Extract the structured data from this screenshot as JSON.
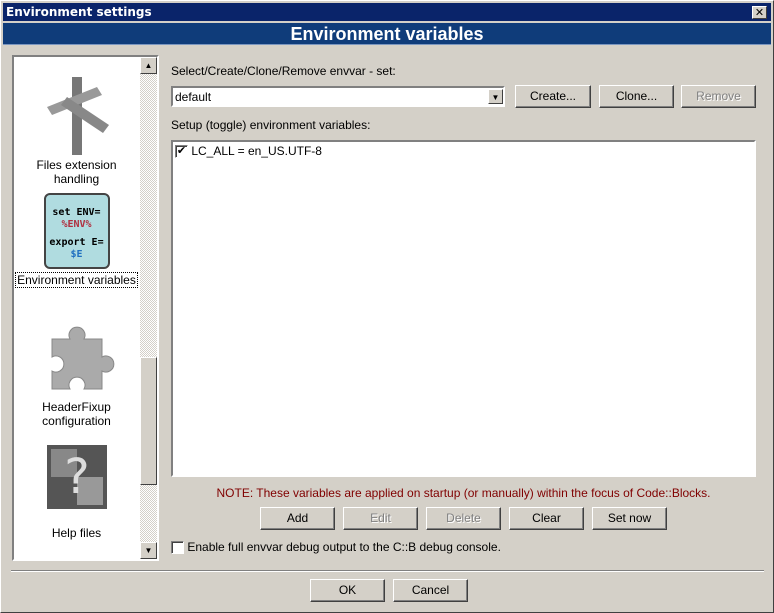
{
  "window": {
    "title": "Environment settings",
    "close": "✕"
  },
  "header": {
    "title": "Environment variables"
  },
  "sidebar": {
    "items": [
      {
        "label": "Files extension handling",
        "icon": "signpost-icon"
      },
      {
        "label": "Environment variables",
        "icon": "script-scroll-icon",
        "selected": true,
        "icon_text": [
          "set ENV=",
          "%ENV%",
          "export E=",
          "$E"
        ]
      },
      {
        "label": "HeaderFixup configuration",
        "icon": "puzzle-icon"
      },
      {
        "label": "Help files",
        "icon": "help-cube-icon"
      }
    ],
    "scroll_up": "▲",
    "scroll_down": "▼"
  },
  "envset": {
    "label": "Select/Create/Clone/Remove envvar - set:",
    "value": "default",
    "create": "Create...",
    "clone": "Clone...",
    "remove": "Remove"
  },
  "vars": {
    "label": "Setup (toggle) environment variables:",
    "items": [
      {
        "text": "LC_ALL = en_US.UTF-8",
        "checked": true
      }
    ]
  },
  "note": {
    "text": "NOTE: These variables are applied on startup (or manually) within the focus of Code::Blocks.",
    "color": "#800000"
  },
  "actions": {
    "add": "Add",
    "edit": "Edit",
    "delete": "Delete",
    "clear": "Clear",
    "set_now": "Set now"
  },
  "debug": {
    "label": "Enable full envvar debug output to the C::B debug console.",
    "checked": false
  },
  "footer": {
    "ok": "OK",
    "cancel": "Cancel"
  }
}
